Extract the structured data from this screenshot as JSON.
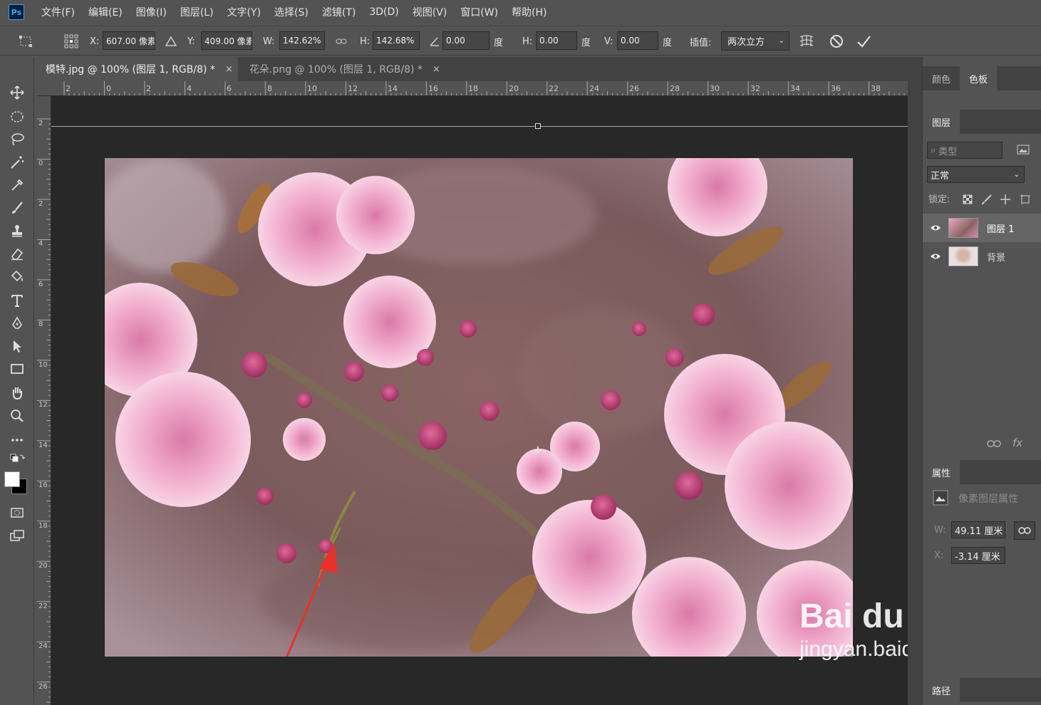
{
  "app": {
    "logo": "Ps"
  },
  "menu": [
    "文件(F)",
    "编辑(E)",
    "图像(I)",
    "图层(L)",
    "文字(Y)",
    "选择(S)",
    "滤镜(T)",
    "3D(D)",
    "视图(V)",
    "窗口(W)",
    "帮助(H)"
  ],
  "options": {
    "x_label": "X:",
    "x_value": "607.00 像素",
    "y_label": "Y:",
    "y_value": "409.00 像素",
    "w_label": "W:",
    "w_value": "142.62%",
    "h_label": "H:",
    "h_value": "142.68%",
    "angle_value": "0.00",
    "angle_unit": "度",
    "hskew_label": "H:",
    "hskew_value": "0.00",
    "hskew_unit": "度",
    "vskew_label": "V:",
    "vskew_value": "0.00",
    "vskew_unit": "度",
    "interp_label": "插值:",
    "interp_value": "两次立方"
  },
  "tabs": [
    {
      "label": "模特.jpg @ 100% (图层 1, RGB/8) *",
      "close": "×"
    },
    {
      "label": "花朵.png @ 100% (图层 1, RGB/8) *",
      "close": "×"
    }
  ],
  "ruler_top": [
    "2",
    "0",
    "2",
    "4",
    "6",
    "8",
    "10",
    "12",
    "14",
    "16",
    "18",
    "20",
    "22",
    "24",
    "26",
    "28",
    "30",
    "32",
    "34",
    "36",
    "38"
  ],
  "ruler_left": [
    "2",
    "0",
    "2",
    "4",
    "6",
    "8",
    "10",
    "12",
    "14",
    "16",
    "18",
    "20",
    "22",
    "24",
    "26"
  ],
  "panels": {
    "top_tabs": [
      "颜色",
      "色板"
    ],
    "layers_tab": "图层",
    "filter_placeholder": "类型",
    "blend_mode": "正常",
    "lock_label": "锁定:",
    "layers": [
      {
        "name": "图层 1",
        "visible": true,
        "selected": true
      },
      {
        "name": "背景",
        "visible": true,
        "selected": false
      }
    ],
    "properties_tab": "属性",
    "properties_title": "像素图层属性",
    "w_label": "W:",
    "w_value": "49.11 厘米",
    "x_label": "X:",
    "x_value": "-3.14 厘米",
    "paths_tab": "路径"
  },
  "watermark": {
    "logo": "Bai du 经验",
    "url": "jingyan.baidu.com"
  },
  "colors": {
    "accent": "#31a8ff",
    "arrow": "#e8312a",
    "canvas_bg": "#282828",
    "ui_bg": "#535353"
  }
}
